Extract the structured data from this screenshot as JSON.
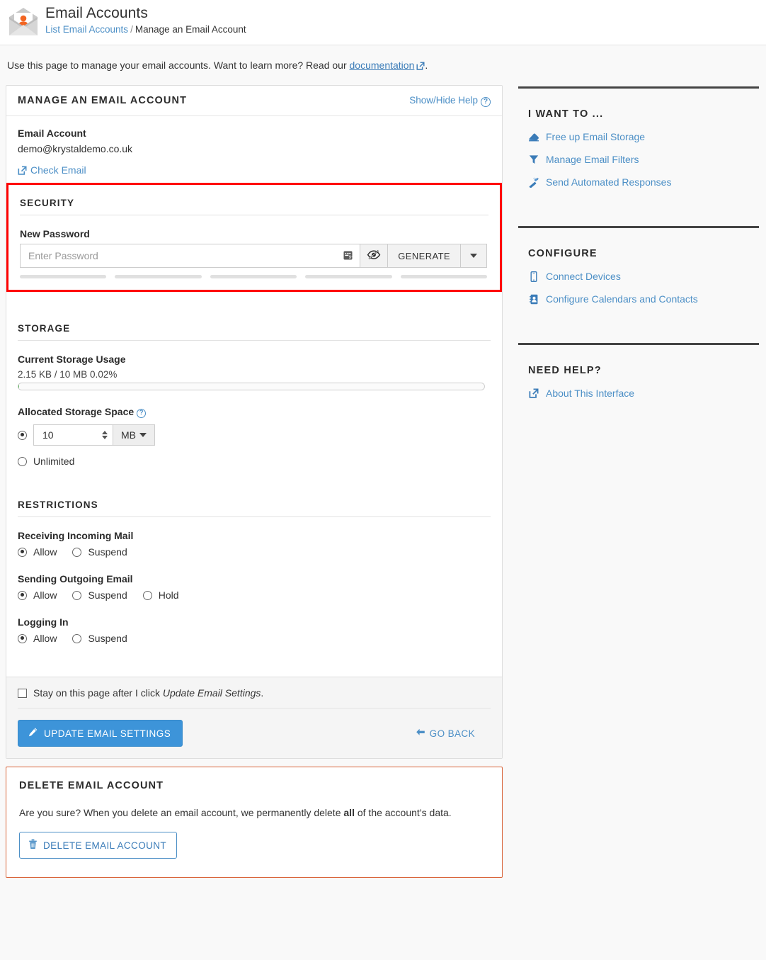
{
  "header": {
    "title": "Email Accounts",
    "icon": "email-account-envelope-icon",
    "breadcrumb": {
      "parent": "List Email Accounts",
      "separator": "/",
      "current": "Manage an Email Account"
    }
  },
  "intro": {
    "text_before": "Use this page to manage your email accounts. Want to learn more? Read our ",
    "link_label": "documentation",
    "link_icon": "external-link-icon",
    "text_after": "."
  },
  "main_panel": {
    "title": "Manage an Email Account",
    "help_toggle_label": "Show/Hide Help",
    "help_icon": "question-circle-icon",
    "email_account": {
      "label": "Email Account",
      "value": "demo@krystaldemo.co.uk",
      "check_email_label": "Check Email",
      "check_email_icon": "external-link-icon"
    },
    "security": {
      "section_title": "Security",
      "highlighted": true,
      "highlight_color": "#ff0000",
      "password_label": "New Password",
      "password_value": "",
      "password_placeholder": "Enter Password",
      "keyboard_icon": "virtual-keyboard-icon",
      "toggle_visibility_icon": "eye-slash-icon",
      "generate_label": "Generate",
      "caret_icon": "caret-down-icon",
      "strength_segments": 5,
      "strength_filled": 0,
      "strength_empty_color": "#e0e0e0"
    },
    "storage": {
      "section_title": "Storage",
      "current_usage_label": "Current Storage Usage",
      "current_usage_value": "2.15 KB / 10 MB 0.02%",
      "usage_percent": 0.02,
      "allocated_label": "Allocated Storage Space",
      "allocated_help_icon": "question-circle-icon",
      "allocated_selected": "quota",
      "quota_value": "10",
      "quota_unit": "MB",
      "quota_unit_caret": "caret-down-icon",
      "spinner_up_icon": "spinner-up-icon",
      "spinner_down_icon": "spinner-down-icon",
      "unlimited_label": "Unlimited"
    },
    "restrictions": {
      "section_title": "Restrictions",
      "groups": [
        {
          "label": "Receiving Incoming Mail",
          "options": [
            "Allow",
            "Suspend"
          ],
          "selected": "Allow"
        },
        {
          "label": "Sending Outgoing Email",
          "options": [
            "Allow",
            "Suspend",
            "Hold"
          ],
          "selected": "Allow"
        },
        {
          "label": "Logging In",
          "options": [
            "Allow",
            "Suspend"
          ],
          "selected": "Allow"
        }
      ]
    },
    "footer": {
      "stay_checkbox_checked": false,
      "stay_text_before": "Stay on this page after I click ",
      "stay_text_italic": "Update Email Settings",
      "stay_text_after": ".",
      "update_button_label": "Update Email Settings",
      "update_button_icon": "pencil-icon",
      "update_button_color": "#3d94d9",
      "go_back_label": "Go Back",
      "go_back_icon": "arrow-left-icon"
    }
  },
  "delete_panel": {
    "title": "Delete Email Account",
    "border_color": "#d9643a",
    "body_before": "Are you sure? When you delete an email account, we permanently delete ",
    "body_bold": "all",
    "body_after": " of the account’s data.",
    "button_label": "Delete Email Account",
    "button_icon": "trash-icon"
  },
  "sidebar": {
    "blocks": [
      {
        "title": "I want to ...",
        "links": [
          {
            "label": "Free up Email Storage",
            "icon": "eraser-icon"
          },
          {
            "label": "Manage Email Filters",
            "icon": "filter-funnel-icon"
          },
          {
            "label": "Send Automated Responses",
            "icon": "magic-wand-icon"
          }
        ]
      },
      {
        "title": "Configure",
        "links": [
          {
            "label": "Connect Devices",
            "icon": "mobile-device-icon"
          },
          {
            "label": "Configure Calendars and Contacts",
            "icon": "address-book-icon"
          }
        ]
      },
      {
        "title": "Need Help?",
        "links": [
          {
            "label": "About This Interface",
            "icon": "external-link-icon"
          }
        ]
      }
    ]
  },
  "colors": {
    "accent_blue": "#4c8fc6",
    "brand_orange": "#f26522",
    "highlight_red": "#ff0000",
    "danger_border": "#d9643a",
    "page_background": "#f9f9f9"
  }
}
